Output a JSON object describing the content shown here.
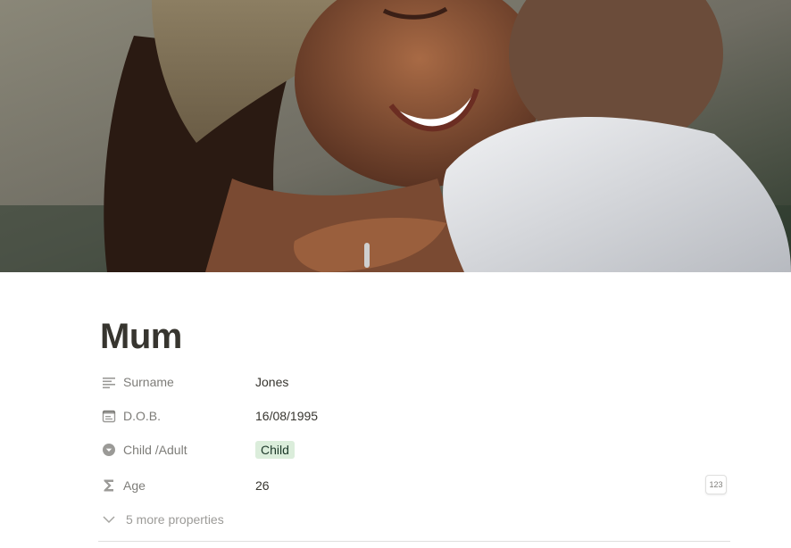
{
  "page": {
    "title": "Mum"
  },
  "cover": {
    "icon": "cover-photo"
  },
  "properties": [
    {
      "icon": "text-lines-icon",
      "label": "Surname",
      "value": "Jones"
    },
    {
      "icon": "calendar-icon",
      "label": "D.O.B.",
      "value": "16/08/1995"
    },
    {
      "icon": "select-icon",
      "label": "Child /Adult",
      "value": "Child",
      "tag_color": "#dbeddb"
    },
    {
      "icon": "sigma-icon",
      "label": "Age",
      "value": "26",
      "badge": "123"
    }
  ],
  "more_properties": {
    "label": "5 more properties",
    "icon": "chevron-down-icon"
  },
  "colors": {
    "text": "#37352f",
    "tag_bg": "#dbeddb"
  }
}
